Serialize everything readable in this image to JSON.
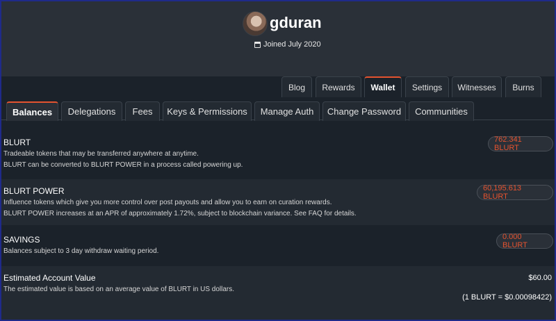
{
  "profile": {
    "username": "gduran",
    "joined": "Joined July 2020"
  },
  "nav_primary": [
    "Blog",
    "Rewards",
    "Wallet",
    "Settings",
    "Witnesses",
    "Burns"
  ],
  "nav_secondary": [
    "Balances",
    "Delegations",
    "Fees",
    "Keys & Permissions",
    "Manage Auth",
    "Change Password",
    "Communities"
  ],
  "balances": {
    "blurt": {
      "title": "BLURT",
      "desc1": "Tradeable tokens that may be transferred anywhere at anytime.",
      "desc2": "BLURT can be converted to BLURT POWER in a process called powering up.",
      "amount": "762.341 BLURT"
    },
    "power": {
      "title": "BLURT POWER",
      "desc1": "Influence tokens which give you more control over post payouts and allow you to earn on curation rewards.",
      "desc2": "BLURT POWER increases at an APR of approximately 1.72%, subject to blockchain variance. See FAQ for details.",
      "amount": "60,195.613 BLURT"
    },
    "savings": {
      "title": "SAVINGS",
      "desc1": "Balances subject to 3 day withdraw waiting period.",
      "amount": "0.000 BLURT"
    },
    "estimate": {
      "title": "Estimated Account Value",
      "desc1": "The estimated value is based on an average value of BLURT in US dollars.",
      "amount": "$60.00",
      "rate": "(1 BLURT = $0.00098422)"
    }
  },
  "colors": {
    "accent": "#e5532f",
    "bg": "#1b222a",
    "panel": "#232a32"
  }
}
